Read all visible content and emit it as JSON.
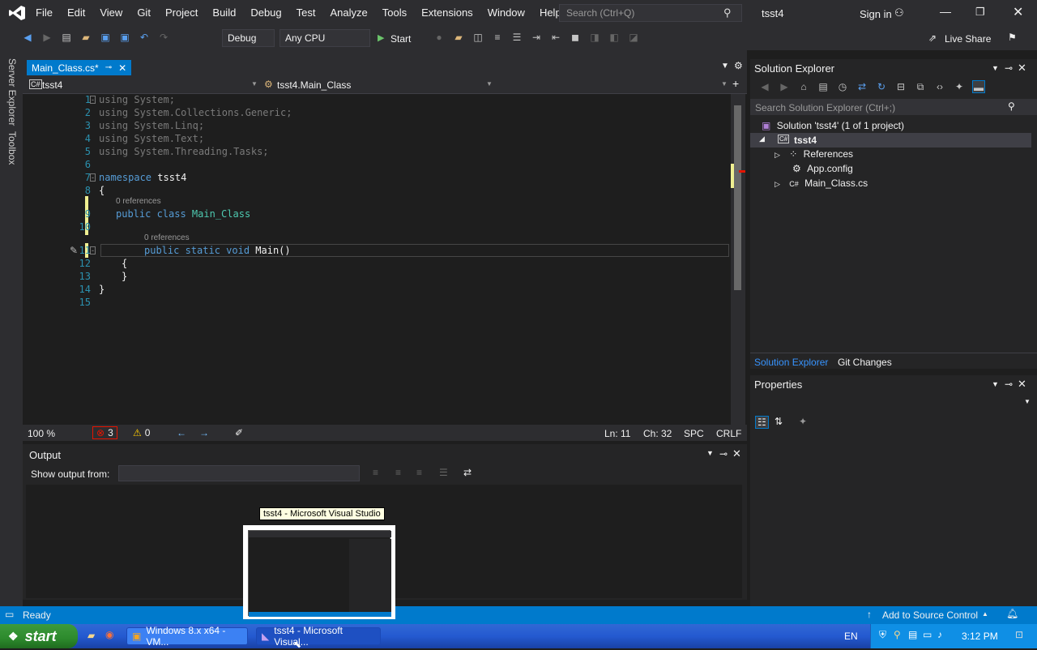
{
  "menu": [
    "File",
    "Edit",
    "View",
    "Git",
    "Project",
    "Build",
    "Debug",
    "Test",
    "Analyze",
    "Tools",
    "Extensions",
    "Window",
    "Help"
  ],
  "search_placeholder": "Search (Ctrl+Q)",
  "solution_title": "tsst4",
  "sign_in": "Sign in",
  "toolbar": {
    "config": "Debug",
    "platform": "Any CPU",
    "start": "Start",
    "live_share": "Live Share"
  },
  "sidebar_tabs": [
    "Server Explorer",
    "Toolbox"
  ],
  "editor": {
    "tab": "Main_Class.cs*",
    "nav_project": "tsst4",
    "nav_class": "tsst4.Main_Class",
    "refs_class": "0 references",
    "refs_method": "0 references",
    "lines": [
      {
        "n": "1",
        "kw": "using",
        "rest": " System;"
      },
      {
        "n": "2",
        "kw": "using",
        "rest": " System.Collections.Generic;"
      },
      {
        "n": "3",
        "kw": "using",
        "rest": " System.Linq;"
      },
      {
        "n": "4",
        "kw": "using",
        "rest": " System.Text;"
      },
      {
        "n": "5",
        "kw": "using",
        "rest": " System.Threading.Tasks;"
      },
      {
        "n": "6",
        "kw": "",
        "rest": ""
      },
      {
        "n": "7",
        "kw": "namespace",
        "rest": " tsst4"
      },
      {
        "n": "8",
        "kw": "",
        "rest": "{"
      },
      {
        "n": "9",
        "kw": "public class",
        "rest": " Main_Class"
      },
      {
        "n": "10",
        "kw": "",
        "rest": ""
      },
      {
        "n": "11",
        "kw": "public static void",
        "rest": " Main()"
      },
      {
        "n": "12",
        "kw": "",
        "rest": "{"
      },
      {
        "n": "13",
        "kw": "",
        "rest": "}"
      },
      {
        "n": "14",
        "kw": "",
        "rest": "}"
      },
      {
        "n": "15",
        "kw": "",
        "rest": ""
      }
    ]
  },
  "editor_status": {
    "zoom": "100 %",
    "errors": "3",
    "warnings": "0",
    "line": "Ln: 11",
    "col": "Ch: 32",
    "spc": "SPC",
    "eol": "CRLF"
  },
  "output": {
    "title": "Output",
    "show_from": "Show output from:"
  },
  "solution_explorer": {
    "title": "Solution Explorer",
    "search": "Search Solution Explorer (Ctrl+;)",
    "tree": [
      "Solution 'tsst4' (1 of 1 project)",
      "tsst4",
      "References",
      "App.config",
      "Main_Class.cs"
    ],
    "tabs": [
      "Solution Explorer",
      "Git Changes"
    ]
  },
  "properties": {
    "title": "Properties"
  },
  "statusbar": {
    "ready": "Ready",
    "source_control": "Add to Source Control"
  },
  "taskbar": {
    "start": "start",
    "btn1": "Windows 8.x x64 - VM...",
    "btn2": "tsst4 - Microsoft Visual...",
    "lang": "EN",
    "time": "3:12 PM",
    "tooltip": "tsst4 - Microsoft Visual Studio"
  }
}
